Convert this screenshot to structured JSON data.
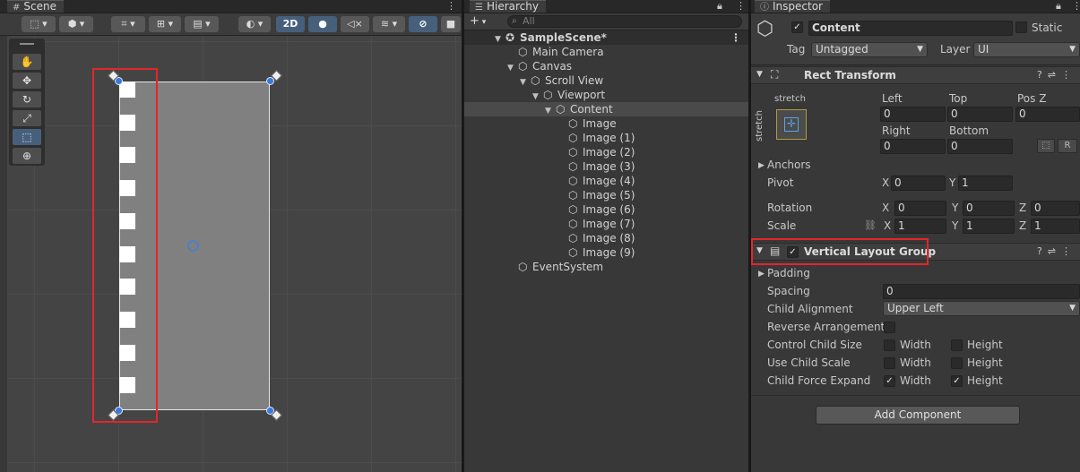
{
  "scene": {
    "tab_label": "Scene",
    "toolbar": {
      "mode_2d_label": "2D"
    },
    "strip_cells": 10
  },
  "hierarchy": {
    "tab_label": "Hierarchy",
    "search_placeholder": "All",
    "items": [
      {
        "label": "SampleScene*",
        "depth": 0,
        "arrow": "▼",
        "kind": "scene"
      },
      {
        "label": "Main Camera",
        "depth": 1,
        "arrow": "",
        "kind": "object"
      },
      {
        "label": "Canvas",
        "depth": 1,
        "arrow": "▼",
        "kind": "object"
      },
      {
        "label": "Scroll View",
        "depth": 2,
        "arrow": "▼",
        "kind": "object"
      },
      {
        "label": "Viewport",
        "depth": 3,
        "arrow": "▼",
        "kind": "object"
      },
      {
        "label": "Content",
        "depth": 4,
        "arrow": "▼",
        "kind": "selected"
      },
      {
        "label": "Image",
        "depth": 5,
        "arrow": "",
        "kind": "object"
      },
      {
        "label": "Image (1)",
        "depth": 5,
        "arrow": "",
        "kind": "object"
      },
      {
        "label": "Image (2)",
        "depth": 5,
        "arrow": "",
        "kind": "object"
      },
      {
        "label": "Image (3)",
        "depth": 5,
        "arrow": "",
        "kind": "object"
      },
      {
        "label": "Image (4)",
        "depth": 5,
        "arrow": "",
        "kind": "object"
      },
      {
        "label": "Image (5)",
        "depth": 5,
        "arrow": "",
        "kind": "object"
      },
      {
        "label": "Image (6)",
        "depth": 5,
        "arrow": "",
        "kind": "object"
      },
      {
        "label": "Image (7)",
        "depth": 5,
        "arrow": "",
        "kind": "object"
      },
      {
        "label": "Image (8)",
        "depth": 5,
        "arrow": "",
        "kind": "object"
      },
      {
        "label": "Image (9)",
        "depth": 5,
        "arrow": "",
        "kind": "object"
      },
      {
        "label": "EventSystem",
        "depth": 1,
        "arrow": "",
        "kind": "object"
      }
    ]
  },
  "inspector": {
    "tab_label": "Inspector",
    "object_name": "Content",
    "static_label": "Static",
    "tag_label": "Tag",
    "tag_value": "Untagged",
    "layer_label": "Layer",
    "layer_value": "UI",
    "rect_transform": {
      "title": "Rect Transform",
      "stretch_label": "stretch",
      "stretch_vertical_label": "stretch",
      "left_label": "Left",
      "left_value": "0",
      "top_label": "Top",
      "top_value": "0",
      "posz_label": "Pos Z",
      "posz_value": "0",
      "right_label": "Right",
      "right_value": "0",
      "bottom_label": "Bottom",
      "bottom_value": "0",
      "r_button": "R",
      "anchors_label": "Anchors",
      "pivot_label": "Pivot",
      "pivot_x": "0",
      "pivot_y": "1",
      "rotation_label": "Rotation",
      "rotation_x": "0",
      "rotation_y": "0",
      "rotation_z": "0",
      "scale_label": "Scale",
      "scale_x": "1",
      "scale_y": "1",
      "scale_z": "1",
      "axis_x": "X",
      "axis_y": "Y",
      "axis_z": "Z"
    },
    "vertical_layout_group": {
      "title": "Vertical Layout Group",
      "padding_label": "Padding",
      "spacing_label": "Spacing",
      "spacing_value": "0",
      "child_alignment_label": "Child Alignment",
      "child_alignment_value": "Upper Left",
      "reverse_label": "Reverse Arrangement",
      "control_size_label": "Control Child Size",
      "use_scale_label": "Use Child Scale",
      "force_expand_label": "Child Force Expand",
      "width_label": "Width",
      "height_label": "Height"
    },
    "add_component_label": "Add Component"
  }
}
